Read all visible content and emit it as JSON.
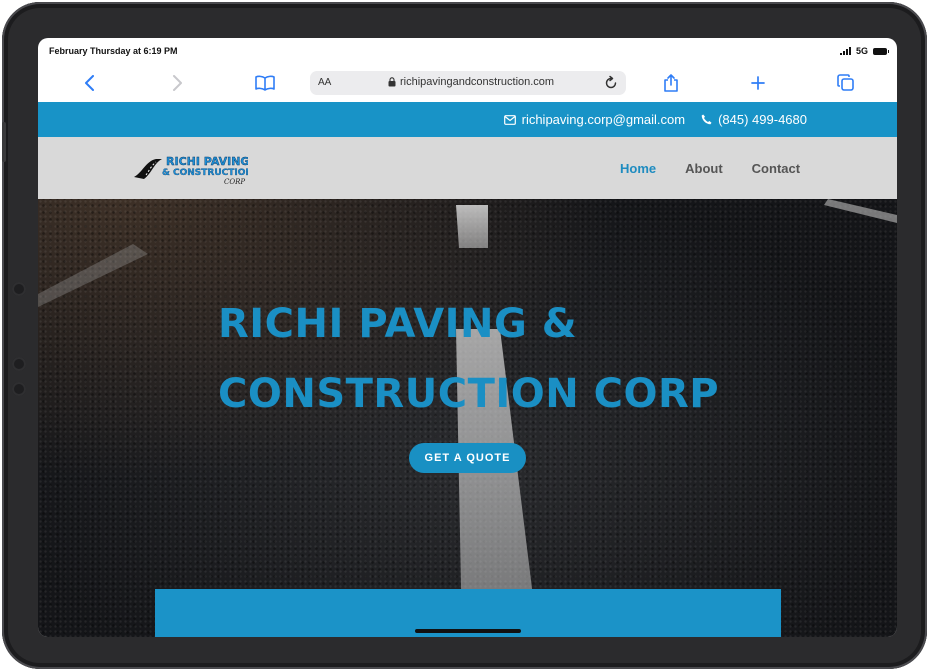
{
  "status_bar": {
    "time": "February Thursday at 6:19 PM",
    "network": "5G"
  },
  "browser": {
    "text_size_label": "AA",
    "url": "richipavingandconstruction.com",
    "icons": [
      "back-icon",
      "forward-icon",
      "bookmarks-icon",
      "lock-icon",
      "reload-icon",
      "share-icon",
      "new-tab-icon",
      "tabs-icon"
    ]
  },
  "contact": {
    "email": "richipaving.corp@gmail.com",
    "phone": "(845) 499-4680"
  },
  "nav": {
    "logo_line1": "RICHI PAVING",
    "logo_line2": "& CONSTRUCTION",
    "logo_line3": "CORP",
    "items": [
      {
        "label": "Home",
        "active": true
      },
      {
        "label": "About",
        "active": false
      },
      {
        "label": "Contact",
        "active": false
      }
    ]
  },
  "hero": {
    "title_line1": "RICHI PAVING &",
    "title_line2": "CONSTRUCTION CORP",
    "cta_label": "GET A QUOTE"
  },
  "colors": {
    "brand_blue": "#1893c7",
    "nav_bg": "#d9d9d9",
    "safari_blue": "#2f7df6"
  }
}
